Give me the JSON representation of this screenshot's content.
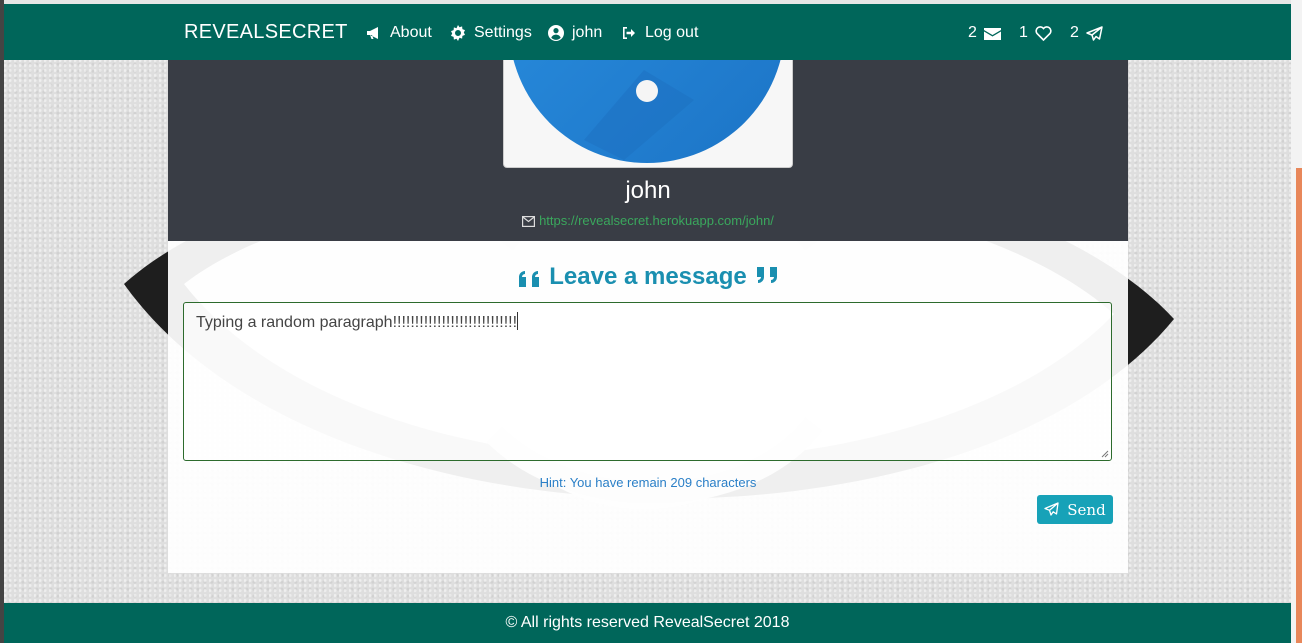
{
  "navbar": {
    "brand": "REVEALSECRET",
    "links": [
      {
        "label": "About",
        "icon": "bullhorn-icon"
      },
      {
        "label": "Settings",
        "icon": "gear-icon"
      },
      {
        "label": "john",
        "icon": "user-circle-icon"
      },
      {
        "label": "Log out",
        "icon": "sign-out-icon"
      }
    ],
    "badges": [
      {
        "count": "2",
        "icon": "envelope-icon"
      },
      {
        "count": "1",
        "icon": "heart-icon"
      },
      {
        "count": "2",
        "icon": "paper-plane-icon"
      }
    ]
  },
  "profile": {
    "username": "john",
    "link": "https://revealsecret.herokuapp.com/john/"
  },
  "message": {
    "title": "Leave a message",
    "text": "Typing a random paragraph!!!!!!!!!!!!!!!!!!!!!!!!!!!!",
    "hint": "Hint: You have remain 209 characters",
    "send_label": "Send"
  },
  "footer": {
    "text": "© All rights reserved RevealSecret 2018"
  },
  "colors": {
    "navbar": "#00665a",
    "profile_panel": "#393d45",
    "title": "#1a8fb0",
    "send_button": "#17a2b8",
    "link": "#3aa75d",
    "avatar_blue": "#2a8fe0"
  }
}
